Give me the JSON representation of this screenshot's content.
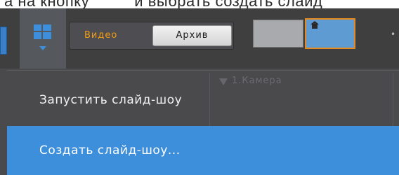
{
  "toolbar": {
    "tab_video": "Видео",
    "tab_archive": "Архив",
    "active_tab": "tab_video",
    "accent_color": "#f39c12",
    "icons": [
      "layout-grid-icon",
      "chevron-down-icon",
      "home-icon"
    ]
  },
  "background": {
    "camera_title": "1.Камера"
  },
  "menu": {
    "items": [
      {
        "label": "Запустить слайд-шоу",
        "selected": false
      },
      {
        "label": "Создать слайд-шоу...",
        "selected": true
      }
    ],
    "highlight_color": "#3d8fdc"
  }
}
